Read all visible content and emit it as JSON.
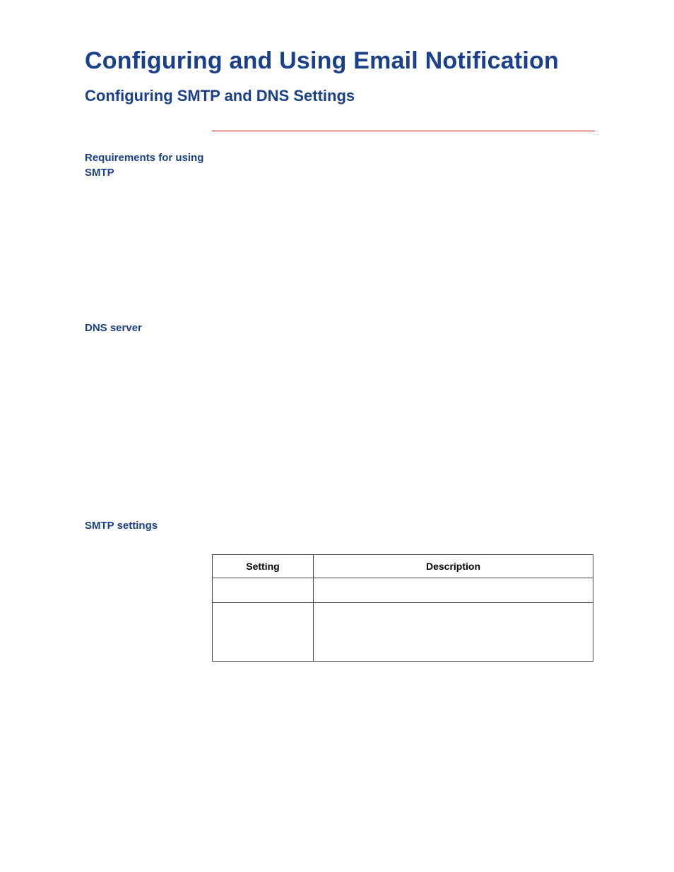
{
  "title": "Configuring and Using Email Notification",
  "subtitle": "Configuring SMTP and DNS Settings",
  "side": {
    "requirements": "Requirements for using SMTP",
    "dns": "DNS server",
    "smtp": "SMTP settings"
  },
  "table": {
    "headers": {
      "setting": "Setting",
      "description": "Description"
    },
    "rows": [
      {
        "setting": "",
        "description": ""
      },
      {
        "setting": "",
        "description": ""
      }
    ]
  }
}
